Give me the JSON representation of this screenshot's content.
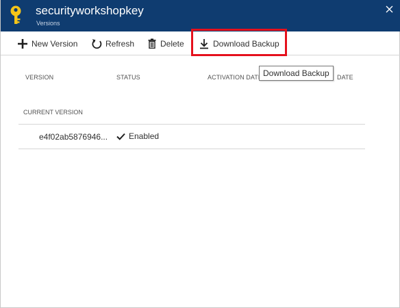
{
  "header": {
    "title": "securityworkshopkey",
    "subtitle": "Versions",
    "icons": {
      "key": "key-icon",
      "close": "close-icon"
    },
    "colors": {
      "background": "#0f3c70",
      "key": "#f5c518"
    }
  },
  "toolbar": {
    "new_version_label": "New Version",
    "refresh_label": "Refresh",
    "delete_label": "Delete",
    "download_backup_label": "Download Backup",
    "icons": {
      "new_version": "plus-icon",
      "refresh": "refresh-icon",
      "delete": "trash-icon",
      "download_backup": "download-icon"
    }
  },
  "highlight_color": "#e5101c",
  "tooltip": {
    "text": "Download Backup"
  },
  "table": {
    "columns": [
      "VERSION",
      "STATUS",
      "ACTIVATION DATE",
      "DATE"
    ],
    "sections": [
      {
        "label": "CURRENT VERSION",
        "rows": [
          {
            "version": "e4f02ab5876946...",
            "status": "Enabled",
            "status_icon": "checkmark-icon"
          }
        ]
      }
    ]
  }
}
